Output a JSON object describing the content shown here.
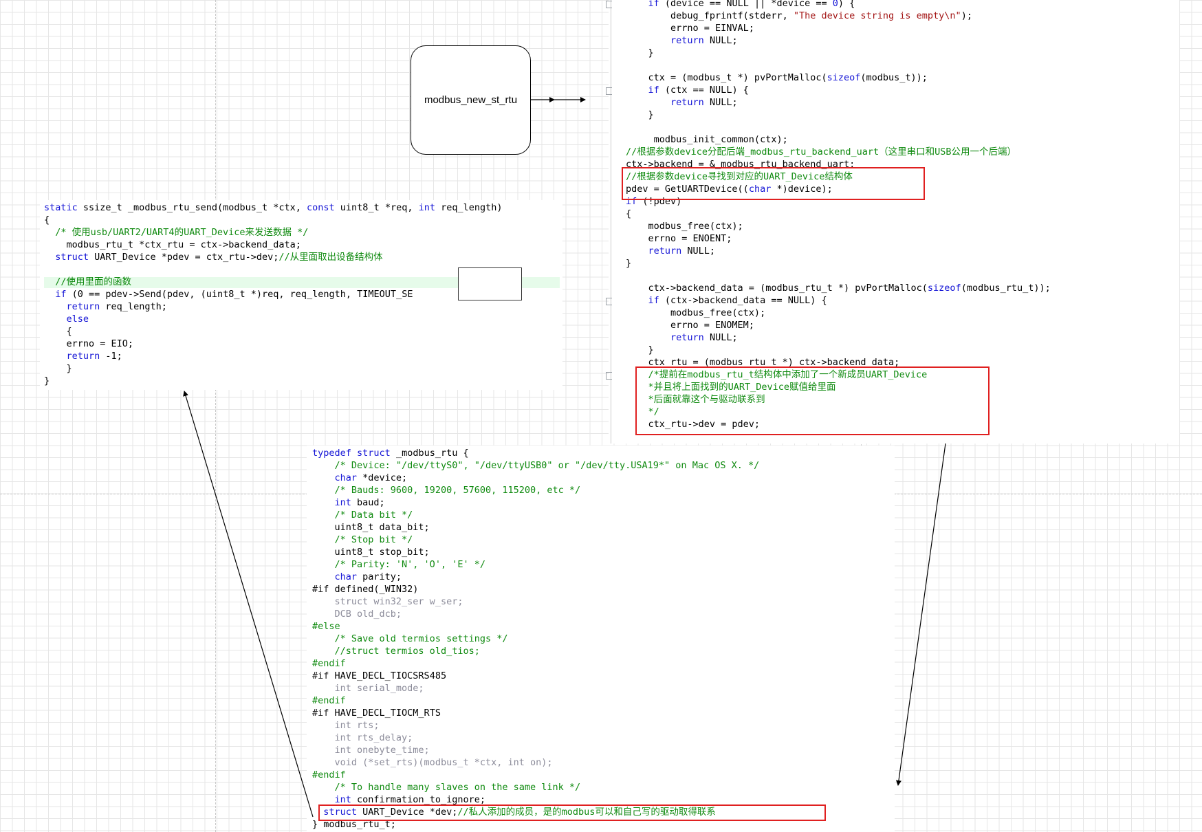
{
  "node": {
    "label": "modbus_new_st_rtu"
  },
  "top_right_code": [
    [
      {
        "t": "    "
      },
      {
        "t": "if",
        "c": "kw"
      },
      {
        "t": " (device == NULL || *device == "
      },
      {
        "t": "0",
        "c": "kw"
      },
      {
        "t": ") {"
      }
    ],
    [
      {
        "t": "        debug_fprintf(stderr, "
      },
      {
        "t": "\"The device string is empty\\n\"",
        "c": "st"
      },
      {
        "t": ");"
      }
    ],
    [
      {
        "t": "        errno = EINVAL;"
      }
    ],
    [
      {
        "t": "        "
      },
      {
        "t": "return",
        "c": "kw"
      },
      {
        "t": " NULL;"
      }
    ],
    [
      {
        "t": "    }"
      }
    ],
    [
      {
        "t": ""
      }
    ],
    [
      {
        "t": "    ctx = (modbus_t *) pvPortMalloc("
      },
      {
        "t": "sizeof",
        "c": "kw"
      },
      {
        "t": "(modbus_t));"
      }
    ],
    [
      {
        "t": "    "
      },
      {
        "t": "if",
        "c": "kw"
      },
      {
        "t": " (ctx == NULL) {"
      }
    ],
    [
      {
        "t": "        "
      },
      {
        "t": "return",
        "c": "kw"
      },
      {
        "t": " NULL;"
      }
    ],
    [
      {
        "t": "    }"
      }
    ],
    [
      {
        "t": ""
      }
    ],
    [
      {
        "t": "     modbus_init_common(ctx);"
      }
    ],
    [
      {
        "t": "//根据参数device分配后端_modbus_rtu_backend_uart（这里串口和USB公用一个后端）",
        "c": "cm"
      }
    ],
    [
      {
        "t": "ctx->backend = &_modbus_rtu_backend_uart;"
      }
    ],
    [
      {
        "t": "//根据参数device寻找到对应的UART_Device结构体",
        "c": "cm"
      }
    ],
    [
      {
        "t": "pdev = GetUARTDevice(("
      },
      {
        "t": "char",
        "c": "kw"
      },
      {
        "t": " *)device);"
      }
    ],
    [
      {
        "t": "if",
        "c": "kw"
      },
      {
        "t": " (!pdev)"
      }
    ],
    [
      {
        "t": "{"
      }
    ],
    [
      {
        "t": "    modbus_free(ctx);"
      }
    ],
    [
      {
        "t": "    errno = ENOENT;"
      }
    ],
    [
      {
        "t": "    "
      },
      {
        "t": "return",
        "c": "kw"
      },
      {
        "t": " NULL;"
      }
    ],
    [
      {
        "t": "}"
      }
    ],
    [
      {
        "t": ""
      }
    ],
    [
      {
        "t": "    ctx->backend_data = (modbus_rtu_t *) pvPortMalloc("
      },
      {
        "t": "sizeof",
        "c": "kw"
      },
      {
        "t": "(modbus_rtu_t));"
      }
    ],
    [
      {
        "t": "    "
      },
      {
        "t": "if",
        "c": "kw"
      },
      {
        "t": " (ctx->backend_data == NULL) {"
      }
    ],
    [
      {
        "t": "        modbus_free(ctx);"
      }
    ],
    [
      {
        "t": "        errno = ENOMEM;"
      }
    ],
    [
      {
        "t": "        "
      },
      {
        "t": "return",
        "c": "kw"
      },
      {
        "t": " NULL;"
      }
    ],
    [
      {
        "t": "    }"
      }
    ],
    [
      {
        "t": "    ctx_rtu = (modbus_rtu_t *) ctx->backend_data;"
      }
    ],
    [
      {
        "t": "    /*提前在modbus_rtu_t结构体中添加了一个新成员UART_Device",
        "c": "cm"
      }
    ],
    [
      {
        "t": "    *并且将上面找到的UART_Device赋值给里面",
        "c": "cm"
      }
    ],
    [
      {
        "t": "    *后面就靠这个与驱动联系到",
        "c": "cm"
      }
    ],
    [
      {
        "t": "    */",
        "c": "cm"
      }
    ],
    [
      {
        "t": "    ctx_rtu->dev = pdev;"
      }
    ]
  ],
  "left_code": [
    [
      {
        "t": "static",
        "c": "kw"
      },
      {
        "t": " ssize_t _modbus_rtu_send(modbus_t *ctx, "
      },
      {
        "t": "const",
        "c": "kw"
      },
      {
        "t": " uint8_t *req, "
      },
      {
        "t": "int",
        "c": "kw"
      },
      {
        "t": " req_length)"
      }
    ],
    [
      {
        "t": "{"
      }
    ],
    [
      {
        "t": "  "
      },
      {
        "t": "/* 使用usb/UART2/UART4的UART_Device来发送数据 */",
        "c": "cm"
      }
    ],
    [
      {
        "t": "    modbus_rtu_t *ctx_rtu = ctx->backend_data;"
      }
    ],
    [
      {
        "t": "  "
      },
      {
        "t": "struct",
        "c": "kw"
      },
      {
        "t": " UART_Device *pdev = ctx_rtu->dev;"
      },
      {
        "t": "//从里面取出设备结构体",
        "c": "cm"
      }
    ],
    [
      {
        "t": ""
      }
    ],
    [
      {
        "t": "  "
      },
      {
        "t": "//使用里面的函数",
        "c": "cm"
      }
    ],
    [
      {
        "t": "  "
      },
      {
        "t": "if",
        "c": "kw"
      },
      {
        "t": " (0 == pdev->Send(pdev, (uint8_t *)req, req_length, TIMEOUT_SE"
      }
    ],
    [
      {
        "t": "    "
      },
      {
        "t": "return",
        "c": "kw"
      },
      {
        "t": " req_length;"
      }
    ],
    [
      {
        "t": "    "
      },
      {
        "t": "else",
        "c": "kw"
      }
    ],
    [
      {
        "t": "    {"
      }
    ],
    [
      {
        "t": "    errno = EIO;"
      }
    ],
    [
      {
        "t": "    "
      },
      {
        "t": "return",
        "c": "kw"
      },
      {
        "t": " -1;"
      }
    ],
    [
      {
        "t": "    }"
      }
    ],
    [
      {
        "t": "}"
      }
    ]
  ],
  "bottom_code": [
    [
      {
        "t": "typedef",
        "c": "kw"
      },
      {
        "t": " "
      },
      {
        "t": "struct",
        "c": "kw"
      },
      {
        "t": " _modbus_rtu {"
      }
    ],
    [
      {
        "t": "    "
      },
      {
        "t": "/* Device: \"/dev/ttyS0\", \"/dev/ttyUSB0\" or \"/dev/tty.USA19*\" on Mac OS X. */",
        "c": "cm"
      }
    ],
    [
      {
        "t": "    "
      },
      {
        "t": "char",
        "c": "kw"
      },
      {
        "t": " *device;"
      }
    ],
    [
      {
        "t": "    "
      },
      {
        "t": "/* Bauds: 9600, 19200, 57600, 115200, etc */",
        "c": "cm"
      }
    ],
    [
      {
        "t": "    "
      },
      {
        "t": "int",
        "c": "kw"
      },
      {
        "t": " baud;"
      }
    ],
    [
      {
        "t": "    "
      },
      {
        "t": "/* Data bit */",
        "c": "cm"
      }
    ],
    [
      {
        "t": "    uint8_t data_bit;"
      }
    ],
    [
      {
        "t": "    "
      },
      {
        "t": "/* Stop bit */",
        "c": "cm"
      }
    ],
    [
      {
        "t": "    uint8_t stop_bit;"
      }
    ],
    [
      {
        "t": "    "
      },
      {
        "t": "/* Parity: 'N', 'O', 'E' */",
        "c": "cm"
      }
    ],
    [
      {
        "t": "    "
      },
      {
        "t": "char",
        "c": "kw"
      },
      {
        "t": " parity;"
      }
    ],
    [
      {
        "t": "#if",
        "c": "pp"
      },
      {
        "t": " defined(_WIN32)"
      }
    ],
    [
      {
        "t": "    "
      },
      {
        "t": "struct win32_ser w_ser;",
        "c": "gr"
      }
    ],
    [
      {
        "t": "    "
      },
      {
        "t": "DCB old_dcb;",
        "c": "gr"
      }
    ],
    [
      {
        "t": "#else",
        "c": "cm"
      }
    ],
    [
      {
        "t": "    "
      },
      {
        "t": "/* Save old termios settings */",
        "c": "cm"
      }
    ],
    [
      {
        "t": "    "
      },
      {
        "t": "//struct termios old_tios;",
        "c": "cm"
      }
    ],
    [
      {
        "t": "#endif",
        "c": "cm"
      }
    ],
    [
      {
        "t": "#if",
        "c": "pp"
      },
      {
        "t": " HAVE_DECL_TIOCSRS485"
      }
    ],
    [
      {
        "t": "    "
      },
      {
        "t": "int serial_mode;",
        "c": "gr"
      }
    ],
    [
      {
        "t": "#endif",
        "c": "cm"
      }
    ],
    [
      {
        "t": "#if",
        "c": "pp"
      },
      {
        "t": " HAVE_DECL_TIOCM_RTS"
      }
    ],
    [
      {
        "t": "    "
      },
      {
        "t": "int rts;",
        "c": "gr"
      }
    ],
    [
      {
        "t": "    "
      },
      {
        "t": "int rts_delay;",
        "c": "gr"
      }
    ],
    [
      {
        "t": "    "
      },
      {
        "t": "int onebyte_time;",
        "c": "gr"
      }
    ],
    [
      {
        "t": "    "
      },
      {
        "t": "void (*set_rts)(modbus_t *ctx, int on);",
        "c": "gr"
      }
    ],
    [
      {
        "t": "#endif",
        "c": "cm"
      }
    ],
    [
      {
        "t": "    "
      },
      {
        "t": "/* To handle many slaves on the same link */",
        "c": "cm"
      }
    ],
    [
      {
        "t": "    "
      },
      {
        "t": "int",
        "c": "kw"
      },
      {
        "t": " confirmation_to_ignore;"
      }
    ],
    [
      {
        "t": "  "
      },
      {
        "t": "struct",
        "c": "kw"
      },
      {
        "t": " UART_Device *dev;"
      },
      {
        "t": "//私人添加的成员，是的modbus可以和自己写的驱动取得联系",
        "c": "cm"
      }
    ],
    [
      {
        "t": "} modbus_rtu_t;"
      }
    ]
  ]
}
